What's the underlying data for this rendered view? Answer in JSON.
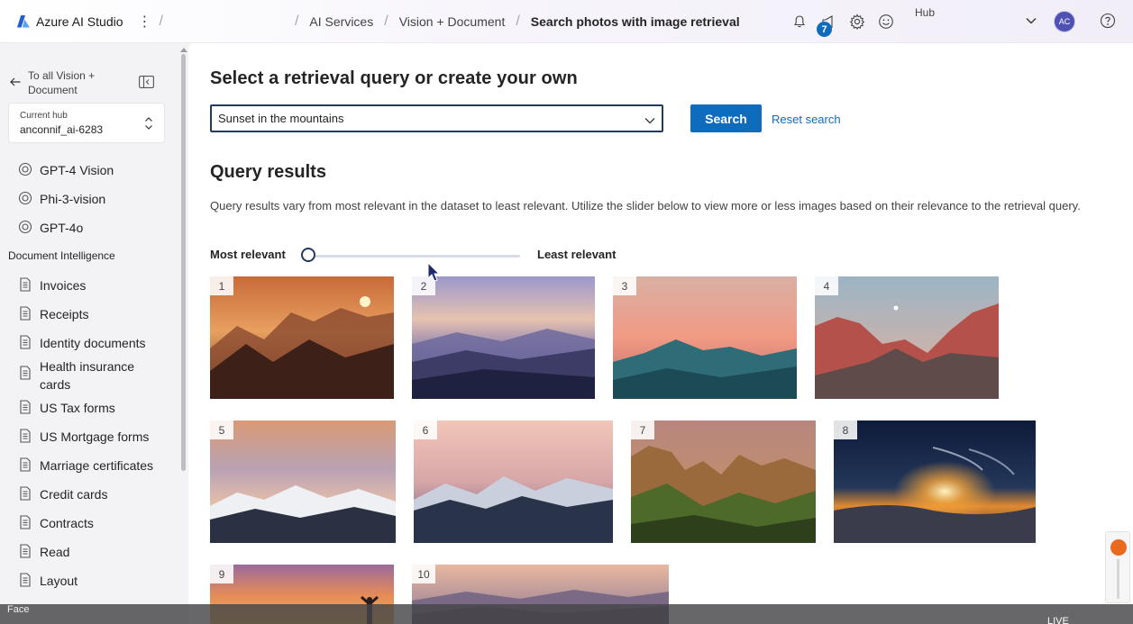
{
  "header": {
    "app_name": "Azure AI Studio",
    "breadcrumbs": [
      "AI Services",
      "Vision + Document",
      "Search photos with image retrieval"
    ],
    "notification_count": "7",
    "hub_label": "Hub",
    "avatar_initials": "AC",
    "icons": [
      "bell-icon",
      "megaphone-icon",
      "gear-icon",
      "smiley-icon",
      "chevron-down-icon",
      "help-icon"
    ]
  },
  "sidebar": {
    "back_label": "To all Vision + Document",
    "hub_card": {
      "label": "Current hub",
      "value": "anconnif_ai-6283"
    },
    "vision_items": [
      "GPT-4 Vision",
      "Phi-3-vision",
      "GPT-4o"
    ],
    "section_document": "Document Intelligence",
    "document_items": [
      "Invoices",
      "Receipts",
      "Identity documents",
      "Health insurance cards",
      "US Tax forms",
      "US Mortgage forms",
      "Marriage certificates",
      "Credit cards",
      "Contracts",
      "Read",
      "Layout"
    ],
    "section_face": "Face"
  },
  "main": {
    "title": "Select a retrieval query or create your own",
    "query_value": "Sunset in the mountains",
    "search_button": "Search",
    "reset_link": "Reset search",
    "results_title": "Query results",
    "results_description": "Query results vary from most relevant in the dataset to least relevant. Utilize the slider below to view more or less images based on their relevance to the retrieval query.",
    "slider": {
      "left_label": "Most relevant",
      "right_label": "Least relevant",
      "position": 0
    },
    "results": [
      {
        "rank": "1",
        "scene": "hazy orange mountain sunset with sun"
      },
      {
        "rank": "2",
        "scene": "purple layered mountain ridges"
      },
      {
        "rank": "3",
        "scene": "pink sky over teal mountain layers"
      },
      {
        "rank": "4",
        "scene": "red rocky cliffs with moon"
      },
      {
        "rank": "5",
        "scene": "snowy peaks under cloudy pink sky"
      },
      {
        "rank": "6",
        "scene": "snowy mountain range at dusk"
      },
      {
        "rank": "7",
        "scene": "green rocky crags at golden hour"
      },
      {
        "rank": "8",
        "scene": "sun setting over sea of clouds"
      },
      {
        "rank": "9",
        "scene": "person silhouette at sunset"
      },
      {
        "rank": "10",
        "scene": "misty purple mountain layers"
      }
    ]
  },
  "overlay": {
    "live_label": "LIVE"
  },
  "colors": {
    "accent": "#0f6cbd",
    "select_border": "#243a5e",
    "sidebar_bg": "#f3f3f6"
  }
}
